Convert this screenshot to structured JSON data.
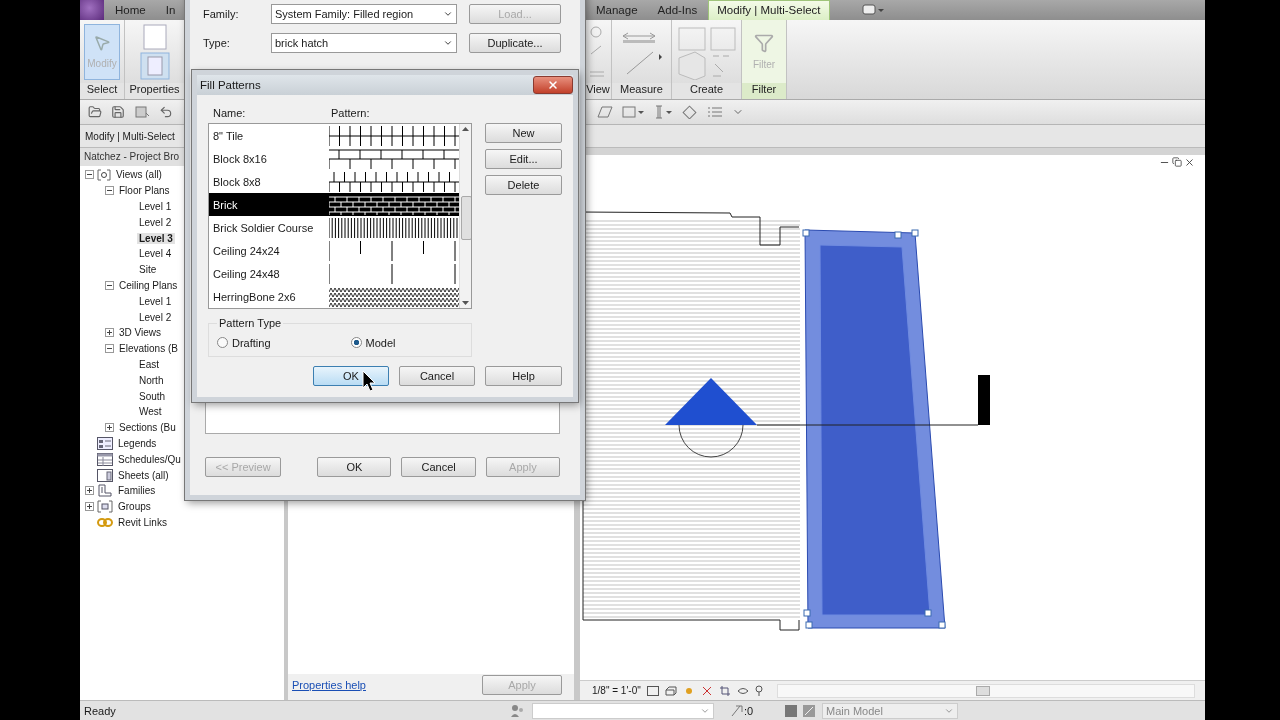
{
  "ribbon": {
    "tabs": [
      {
        "label": "Home",
        "selected": false
      },
      {
        "label": "In",
        "selected": false
      },
      {
        "label": "Manage",
        "selected": false
      },
      {
        "label": "Add-Ins",
        "selected": false
      },
      {
        "label": "Modify | Multi-Select",
        "selected": true
      }
    ],
    "modify_button": {
      "label": "Modify",
      "selected": true
    },
    "left_panels": [
      "Select",
      "Properties"
    ],
    "right_panels": [
      "View",
      "Measure",
      "Create",
      "Filter"
    ],
    "filter_button": {
      "label": "Filter",
      "disabled": true
    }
  },
  "options_bar": {
    "label": "Modify | Multi-Select"
  },
  "project_browser": {
    "title": "Natchez - Project Bro",
    "tree": [
      {
        "label": "Views (all)",
        "kind": "views",
        "expanded": true,
        "selected": false,
        "children": [
          {
            "label": "Floor Plans",
            "expanded": true,
            "selected": false,
            "children": [
              {
                "label": "Level 1",
                "selected": false
              },
              {
                "label": "Level 2",
                "selected": false
              },
              {
                "label": "Level 3",
                "selected": true
              },
              {
                "label": "Level 4",
                "selected": false
              },
              {
                "label": "Site",
                "selected": false
              }
            ]
          },
          {
            "label": "Ceiling Plans",
            "expanded": true,
            "selected": false,
            "children": [
              {
                "label": "Level 1",
                "selected": false
              },
              {
                "label": "Level 2",
                "selected": false
              }
            ]
          },
          {
            "label": "3D Views",
            "expanded": false,
            "selected": false
          },
          {
            "label": "Elevations (B",
            "expanded": true,
            "selected": false,
            "children": [
              {
                "label": "East",
                "selected": false
              },
              {
                "label": "North",
                "selected": false
              },
              {
                "label": "South",
                "selected": false
              },
              {
                "label": "West",
                "selected": false
              }
            ]
          },
          {
            "label": "Sections (Bu",
            "expanded": false,
            "selected": false
          }
        ]
      },
      {
        "label": "Legends",
        "kind": "legend",
        "selected": false
      },
      {
        "label": "Schedules/Qu",
        "kind": "schedule",
        "selected": false
      },
      {
        "label": "Sheets (all)",
        "kind": "sheet",
        "selected": false
      },
      {
        "label": "Families",
        "kind": "family",
        "expanded": false,
        "selected": false
      },
      {
        "label": "Groups",
        "kind": "group",
        "expanded": false,
        "selected": false
      },
      {
        "label": "Revit Links",
        "kind": "link",
        "selected": false
      }
    ]
  },
  "properties": {
    "help_link": "Properties help",
    "apply": {
      "label": "Apply",
      "disabled": true
    }
  },
  "view": {
    "scale": "1/8\" = 1'-0\""
  },
  "status_bar": {
    "text": "Ready",
    "counter": ":0",
    "workset": "Main Model"
  },
  "type_properties": {
    "family_label": "Family:",
    "family": "System Family: Filled region",
    "type_label": "Type:",
    "type": "brick hatch",
    "side_buttons": [
      {
        "label": "Load...",
        "disabled": true
      },
      {
        "label": "Duplicate...",
        "disabled": false
      }
    ],
    "footer_buttons": [
      {
        "label": "<< Preview",
        "disabled": true
      },
      {
        "label": "OK",
        "disabled": false
      },
      {
        "label": "Cancel",
        "disabled": false
      },
      {
        "label": "Apply",
        "disabled": true
      }
    ]
  },
  "fill_patterns": {
    "title": "Fill Patterns",
    "name_header": "Name:",
    "pattern_header": "Pattern:",
    "patterns": [
      {
        "name": "8\" Tile",
        "kind": "tile",
        "selected": false
      },
      {
        "name": "Block 8x16",
        "kind": "block16",
        "selected": false
      },
      {
        "name": "Block 8x8",
        "kind": "block8",
        "selected": false
      },
      {
        "name": "Brick",
        "kind": "brick",
        "selected": true
      },
      {
        "name": "Brick Soldier Course",
        "kind": "soldier",
        "selected": false
      },
      {
        "name": "Ceiling 24x24",
        "kind": "ceiling24",
        "selected": false
      },
      {
        "name": "Ceiling 24x48",
        "kind": "ceiling48",
        "selected": false
      },
      {
        "name": "HerringBone 2x6",
        "kind": "herringbone",
        "selected": false
      }
    ],
    "side_buttons": [
      "New",
      "Edit...",
      "Delete"
    ],
    "pattern_type": {
      "label": "Pattern Type",
      "options": [
        {
          "label": "Drafting",
          "selected": false
        },
        {
          "label": "Model",
          "selected": true
        }
      ]
    },
    "buttons": [
      {
        "label": "OK",
        "focused": true
      },
      {
        "label": "Cancel",
        "focused": false
      },
      {
        "label": "Help",
        "focused": false
      }
    ]
  }
}
